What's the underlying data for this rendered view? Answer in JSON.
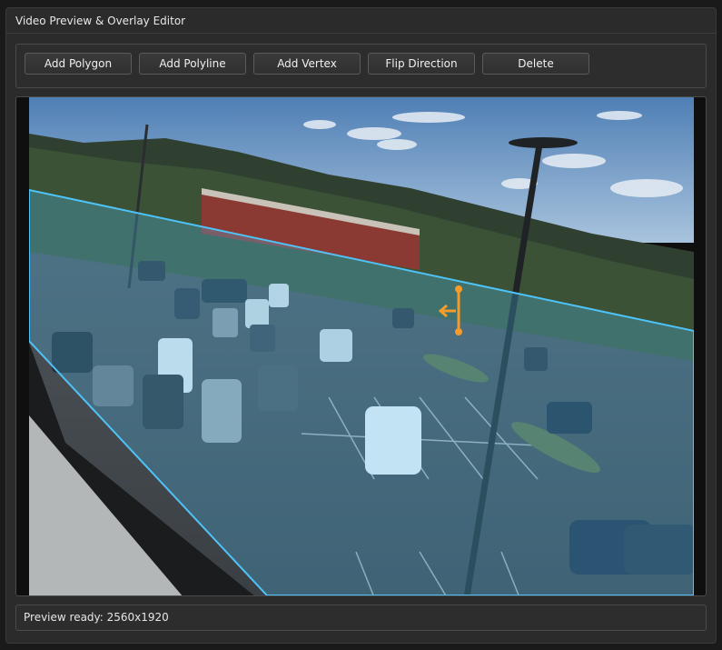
{
  "window": {
    "title": "Video Preview & Overlay Editor"
  },
  "toolbar": {
    "add_polygon": "Add Polygon",
    "add_polyline": "Add Polyline",
    "add_vertex": "Add Vertex",
    "flip_direction": "Flip Direction",
    "delete": "Delete"
  },
  "preview": {
    "content": "parking-lot-camera-frame",
    "overlay_color": "#4fc3f7",
    "polyline_color": "#f39c2b"
  },
  "status": {
    "text": "Preview ready: 2560x1920"
  }
}
